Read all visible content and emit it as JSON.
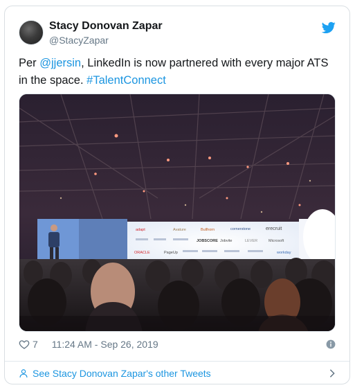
{
  "tweet": {
    "author_name": "Stacy Donovan Zapar",
    "author_handle": "@StacyZapar",
    "text_prefix": "Per ",
    "mention": "@jjersin",
    "text_body": ", LinkedIn is now partnered with every major ATS in the space. ",
    "hashtag": "#TalentConnect",
    "like_count": "7",
    "timestamp": "11:24 AM - Sep 26, 2019",
    "footer_link": "See Stacy Donovan Zapar's other Tweets"
  },
  "media": {
    "screen_logos": {
      "row1": [
        "adapt",
        "Avature",
        "Bullhorn",
        "cornerstone",
        "erecruit"
      ],
      "row2": [
        "Jobvite",
        "LEVER",
        "Microsoft",
        "JOBSCORE"
      ],
      "row3": [
        "ORACLE",
        "PageUp",
        "workday"
      ]
    }
  },
  "colors": {
    "link": "#1b95e0",
    "secondary_text": "#657786",
    "twitter_blue": "#1da1f2",
    "border": "#e1e8ed"
  },
  "icons": {
    "bird": "twitter-bird-icon",
    "heart": "heart-icon",
    "info": "info-icon",
    "person": "person-icon",
    "chevron": "chevron-right-icon"
  }
}
